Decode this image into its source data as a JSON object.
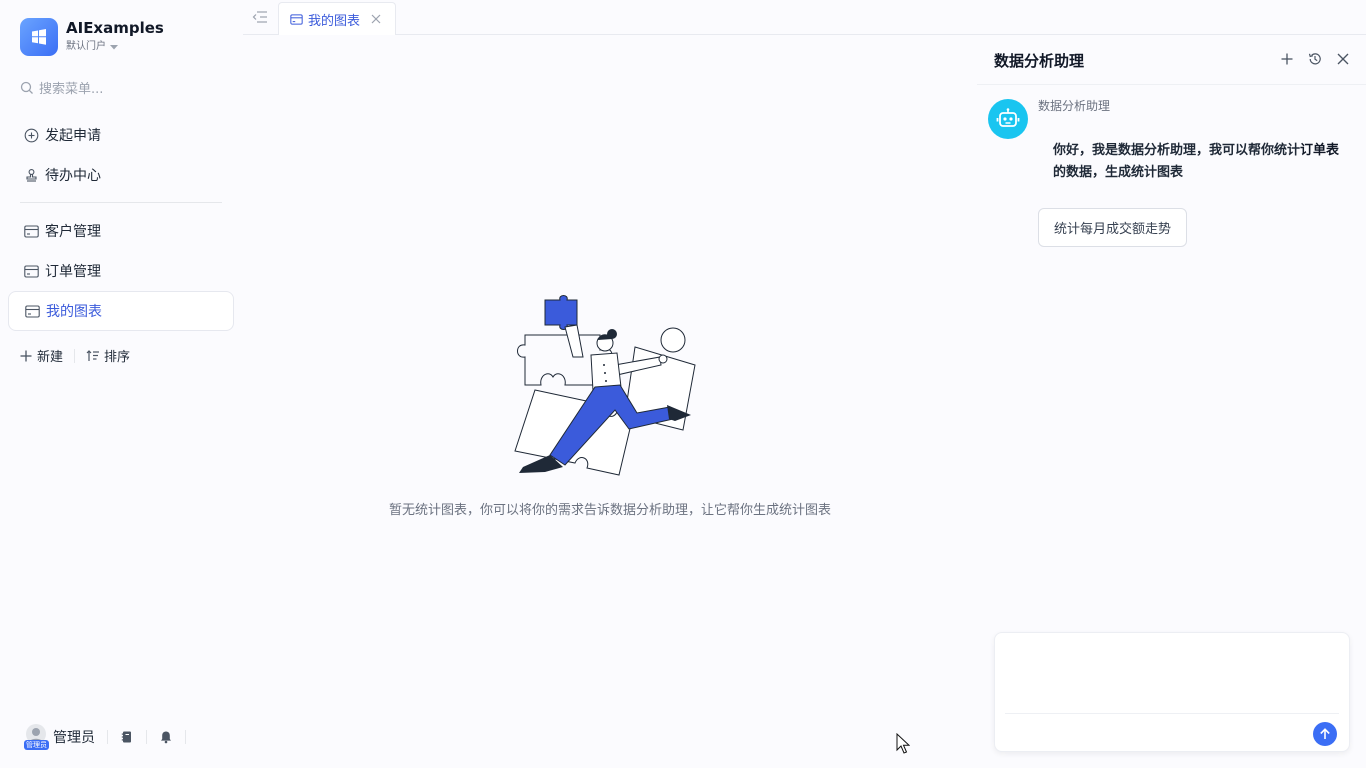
{
  "app": {
    "title": "AIExamples",
    "portal": "默认门户"
  },
  "search": {
    "placeholder": "搜索菜单..."
  },
  "nav": {
    "top": [
      {
        "label": "发起申请",
        "icon": "plus-circle-icon"
      },
      {
        "label": "待办中心",
        "icon": "stamp-icon"
      }
    ],
    "pages": [
      {
        "label": "客户管理",
        "icon": "card-icon"
      },
      {
        "label": "订单管理",
        "icon": "card-icon"
      },
      {
        "label": "我的图表",
        "icon": "card-icon",
        "active": true
      }
    ]
  },
  "actions": {
    "new_label": "新建",
    "sort_label": "排序"
  },
  "user": {
    "name": "管理员",
    "badge": "管理员"
  },
  "tabs": [
    {
      "label": "我的图表",
      "active": true
    }
  ],
  "main": {
    "empty_text": "暂无统计图表，你可以将你的需求告诉数据分析助理，让它帮你生成统计图表"
  },
  "assistant": {
    "title": "数据分析助理",
    "bot_name": "数据分析助理",
    "message_before": "你好，我是数据分析助理，我可以帮你统计",
    "message_emphasis": "订单表",
    "message_after": "的数据，生成统计图表",
    "suggestion": "统计每月成交额走势",
    "input_value": ""
  },
  "colors": {
    "accent": "#3b5bdb",
    "brand": "#3b6ef5",
    "bot": "#19c5f0"
  }
}
